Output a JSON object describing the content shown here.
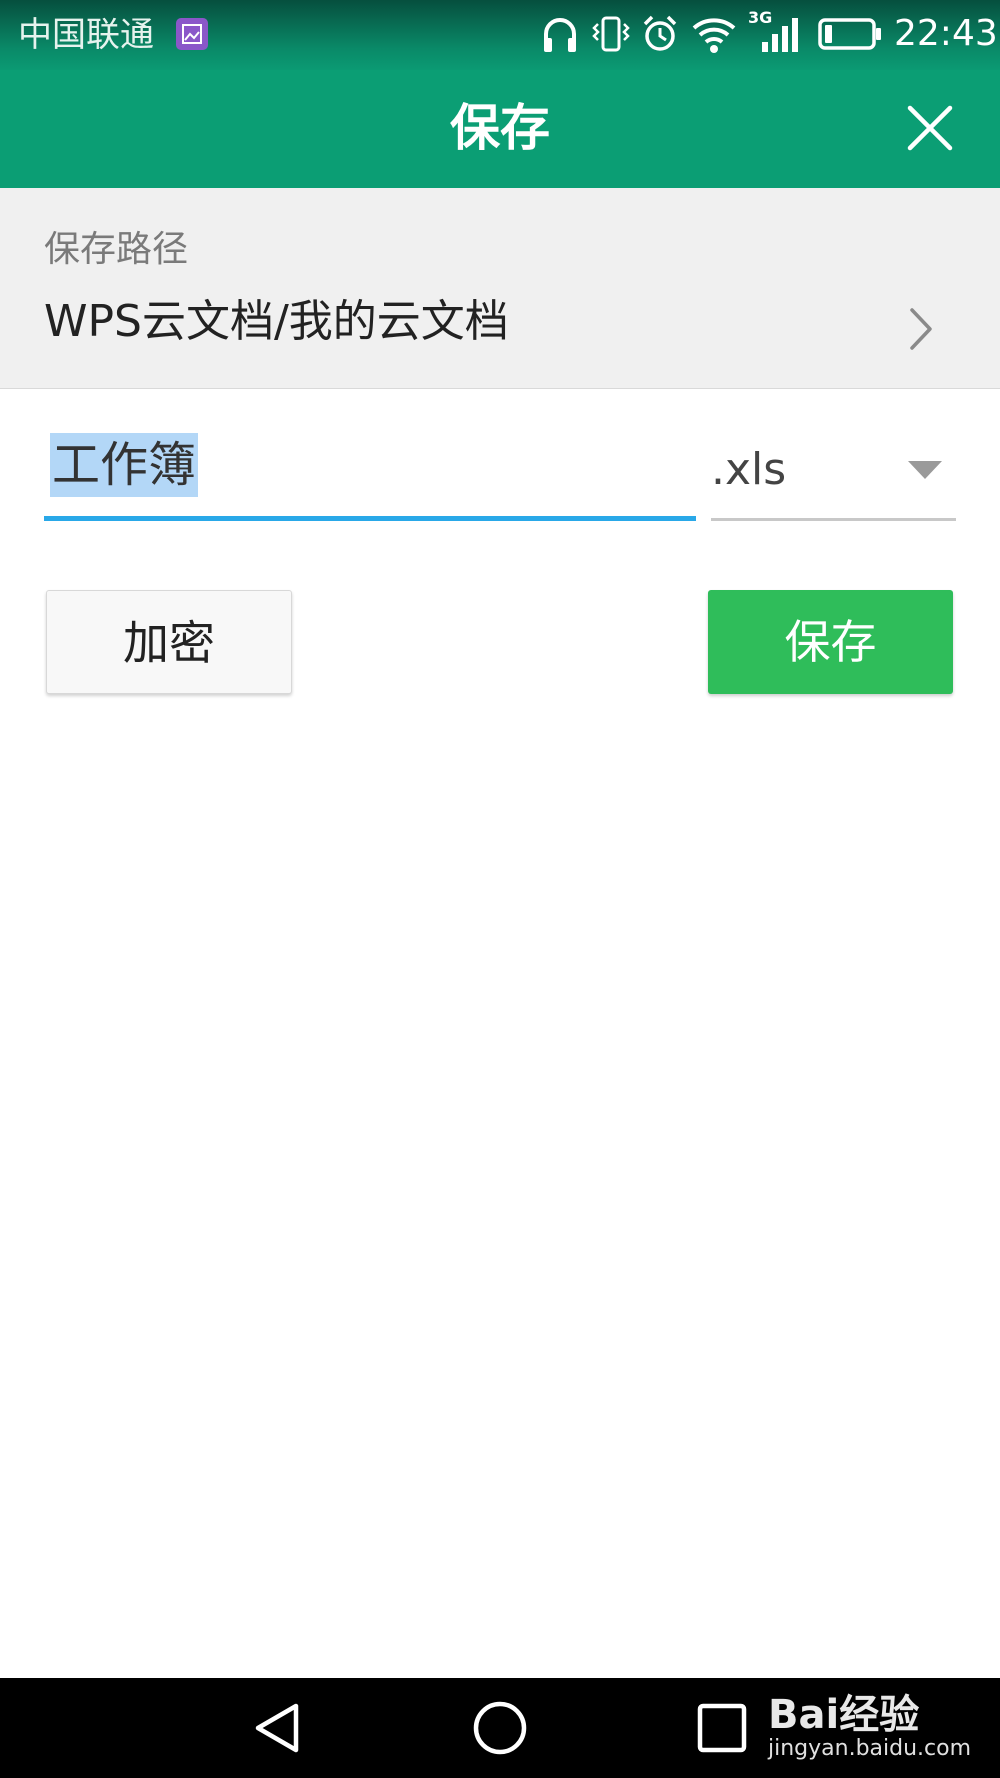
{
  "status_bar": {
    "carrier": "中国联通",
    "network_type": "3G",
    "time": "22:43",
    "icons": [
      "image-notification-icon",
      "headphones-icon",
      "vibrate-icon",
      "alarm-icon",
      "wifi-icon",
      "signal-icon",
      "battery-icon"
    ]
  },
  "app_bar": {
    "title": "保存",
    "close_icon": "close-icon"
  },
  "save_path": {
    "label": "保存路径",
    "value": "WPS云文档/我的云文档",
    "chevron_icon": "chevron-right-icon"
  },
  "file_name": {
    "value": "工作簿",
    "selected": true
  },
  "extension": {
    "selected": ".xls",
    "dropdown_icon": "dropdown-arrow-icon"
  },
  "buttons": {
    "encrypt_label": "加密",
    "save_label": "保存"
  },
  "nav_bar": {
    "icons": [
      "back-icon",
      "home-icon",
      "recents-icon"
    ]
  },
  "watermark": {
    "brand": "Bai经验",
    "url": "jingyan.baidu.com"
  },
  "colors": {
    "app_bar": "#0b9e74",
    "save_button": "#2fbd5a",
    "input_focus_underline": "#29a8e8",
    "text_selection": "#b3d7f7"
  }
}
